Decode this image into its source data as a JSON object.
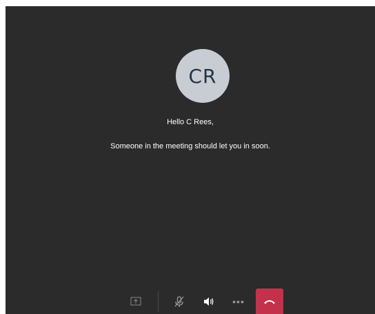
{
  "lobby": {
    "avatar_initials": "CR",
    "greeting": "Hello C Rees,",
    "status_message": "Someone in the meeting should let you in soon."
  },
  "controls": {
    "share_icon": "share-screen-icon",
    "mic_icon": "mic-muted-icon",
    "speaker_icon": "speaker-icon",
    "more_icon": "more-options-icon",
    "hangup_icon": "hang-up-icon",
    "more_label": "•••"
  },
  "colors": {
    "background": "#2b2b2b",
    "avatar_bg": "#c8ccd3",
    "avatar_text": "#243447",
    "hangup": "#c4314b"
  }
}
